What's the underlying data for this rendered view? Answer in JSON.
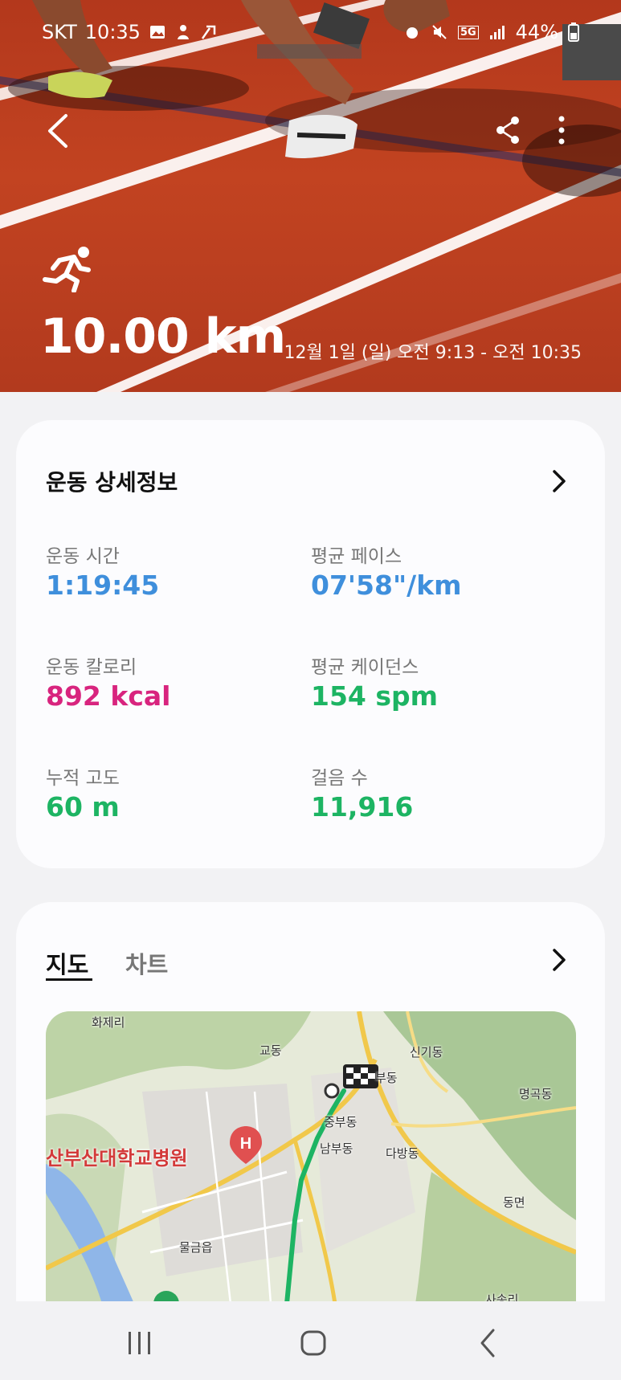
{
  "status_bar": {
    "carrier": "SKT",
    "time": "10:35",
    "network": "5G",
    "battery": "44%"
  },
  "hero": {
    "distance": "10.00 km",
    "date_range": "12월 1일 (일) 오전 9:13 - 오전 10:35",
    "activity_icon": "running-icon"
  },
  "details": {
    "title": "운동 상세정보",
    "stats": [
      {
        "label": "운동 시간",
        "value": "1:19:45",
        "color": "#3f8fdc"
      },
      {
        "label": "평균 페이스",
        "value": "07'58\"/km",
        "color": "#3f8fdc"
      },
      {
        "label": "운동 칼로리",
        "value": "892 kcal",
        "color": "#d8247e"
      },
      {
        "label": "평균 케이던스",
        "value": "154 spm",
        "color": "#1db463"
      },
      {
        "label": "누적 고도",
        "value": "60 m",
        "color": "#1db463"
      },
      {
        "label": "걸음 수",
        "value": "11,916",
        "color": "#1db463"
      }
    ]
  },
  "map_card": {
    "tabs": [
      "지도",
      "차트"
    ],
    "active_tab": "지도",
    "labels": {
      "hwajeri": "화제리",
      "gyodong": "교동",
      "singidong": "신기동",
      "bubudong": "부동",
      "myeonggokdong": "명곡동",
      "jungbudong": "중부동",
      "nambudong": "남부동",
      "dabangdong": "다방동",
      "hospital": "산부산대학교병원",
      "dongmyeon": "동면",
      "mulgeumeup": "물금읍",
      "sasongri": "사송리"
    },
    "route_color": "#1db463"
  }
}
